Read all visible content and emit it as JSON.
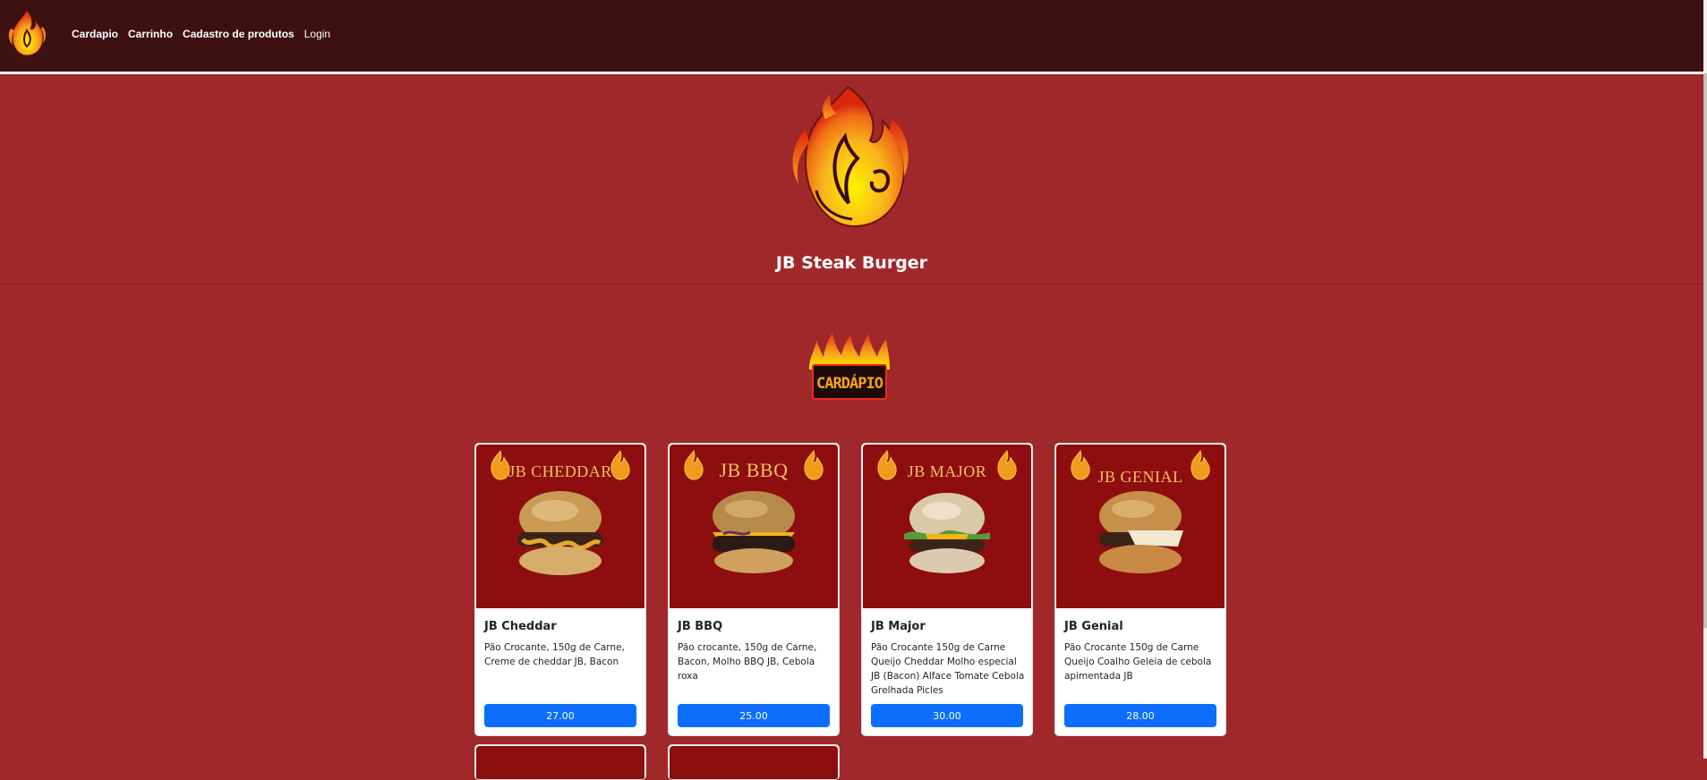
{
  "nav": {
    "logo_icon": "flame-logo-icon",
    "links": [
      {
        "label": "Cardapio"
      },
      {
        "label": "Carrinho"
      },
      {
        "label": "Cadastro de produtos"
      },
      {
        "label": "Login"
      }
    ]
  },
  "hero": {
    "logo_icon": "flame-logo-icon",
    "title": "JB Steak Burger"
  },
  "menu_badge": {
    "label": "CARDÁPIO",
    "icon": "flames-icon"
  },
  "products": [
    {
      "image_title": "JB CHEDDAR",
      "name": "JB Cheddar",
      "description": "Pão Crocante, 150g de Carne, Creme de cheddar JB, Bacon",
      "price": "27.00"
    },
    {
      "image_title": "JB BBQ",
      "name": "JB BBQ",
      "description": "Pão crocante, 150g de Carne, Bacon, Molho BBQ JB, Cebola roxa",
      "price": "25.00"
    },
    {
      "image_title": "JB MAJOR",
      "name": "JB Major",
      "description": "Pão Crocante 150g de Carne Queijo Cheddar Molho especial JB (Bacon) Alface Tomate Cebola Grelhada Picles",
      "price": "30.00"
    },
    {
      "image_title": "JB GENIAL",
      "name": "JB Genial",
      "description": "Pão Crocante 150g de Carne Queijo Coalho Geleia de cebola apimentada JB",
      "price": "28.00"
    }
  ],
  "colors": {
    "navbar": "#3d1011",
    "page_background": "#a1282a",
    "card_image_background": "#8e0e0f",
    "price_button": "#0d6efd",
    "card_background": "#ffffff"
  }
}
